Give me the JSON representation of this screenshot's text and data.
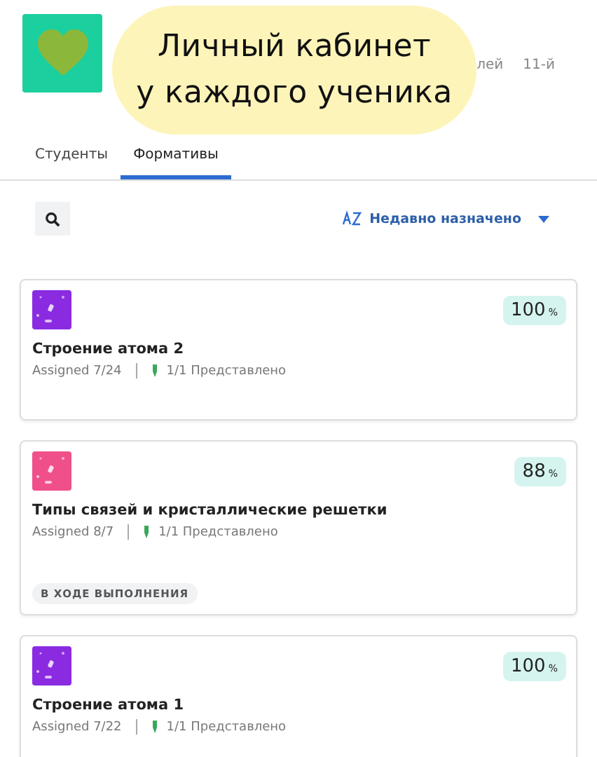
{
  "header": {
    "tail_texts": [
      "лей",
      "11-й"
    ]
  },
  "overlay": {
    "lines": [
      "Личный кабинет",
      "у каждого ученика"
    ]
  },
  "tabs": [
    {
      "label": "Студенты",
      "selected": false
    },
    {
      "label": "Формативы",
      "selected": true
    }
  ],
  "sort": {
    "label": "Недавно назначено"
  },
  "cards": [
    {
      "color": "#8a2be2",
      "score": "100",
      "unit": "%",
      "title": "Строение атома 2",
      "assigned": "Assigned 7/24",
      "submitted": "1/1 Представлено"
    },
    {
      "color": "#f0508a",
      "score": "88",
      "unit": "%",
      "title": "Типы связей и кристаллические решетки",
      "assigned": "Assigned 8/7",
      "submitted": "1/1 Представлено",
      "status": "В ХОДЕ ВЫПОЛНЕНИЯ"
    },
    {
      "color": "#8a2be2",
      "score": "100",
      "unit": "%",
      "title": "Строение атома 1",
      "assigned": "Assigned 7/22",
      "submitted": "1/1 Представлено"
    }
  ]
}
